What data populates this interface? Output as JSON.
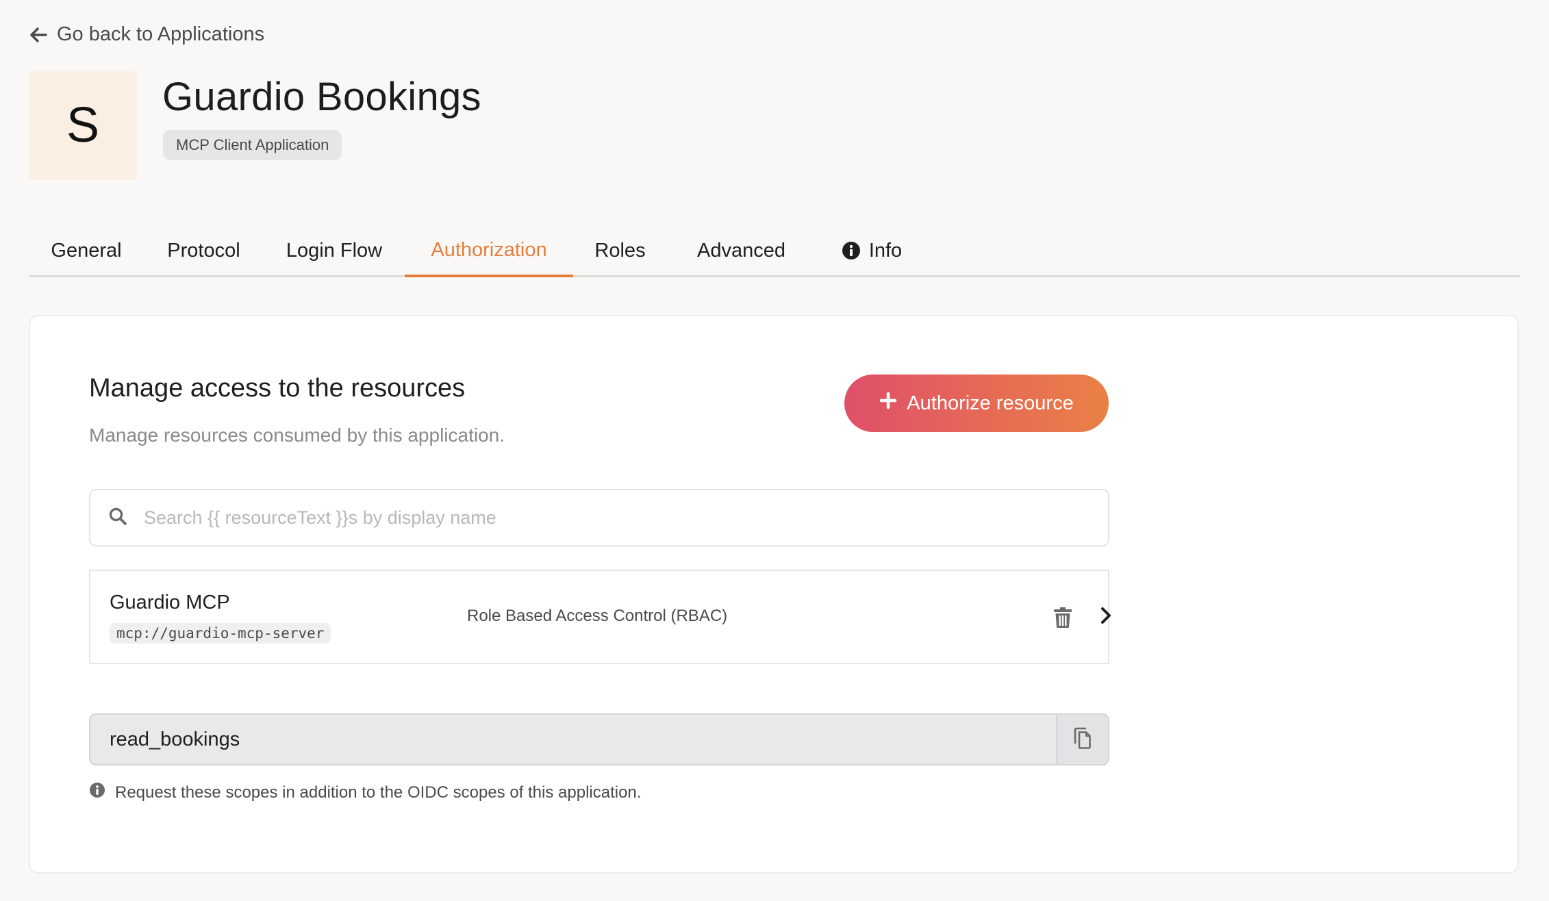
{
  "nav": {
    "back_label": "Go back to Applications"
  },
  "app": {
    "avatar_letter": "S",
    "name": "Guardio Bookings",
    "type_badge": "MCP Client Application"
  },
  "tabs": [
    {
      "label": "General"
    },
    {
      "label": "Protocol"
    },
    {
      "label": "Login Flow"
    },
    {
      "label": "Authorization",
      "active": true
    },
    {
      "label": "Roles"
    },
    {
      "label": "Advanced"
    },
    {
      "label": "Info",
      "icon": "info-icon"
    }
  ],
  "section": {
    "title": "Manage access to the resources",
    "subtitle": "Manage resources consumed by this application.",
    "authorize_label": "Authorize resource"
  },
  "search": {
    "placeholder": "Search {{ resourceText }}s by display name",
    "value": ""
  },
  "resources": [
    {
      "name": "Guardio MCP",
      "identifier": "mcp://guardio-mcp-server",
      "access_policy": "Role Based Access Control (RBAC)"
    }
  ],
  "scopes": {
    "value": "read_bookings",
    "hint": "Request these scopes in addition to the OIDC scopes of this application."
  },
  "colors": {
    "accent": "#e67e3a",
    "button_gradient_start": "#df4f6a",
    "button_gradient_end": "#ea8145",
    "page_background": "#f9f8f7",
    "avatar_background": "#fbefe4"
  }
}
